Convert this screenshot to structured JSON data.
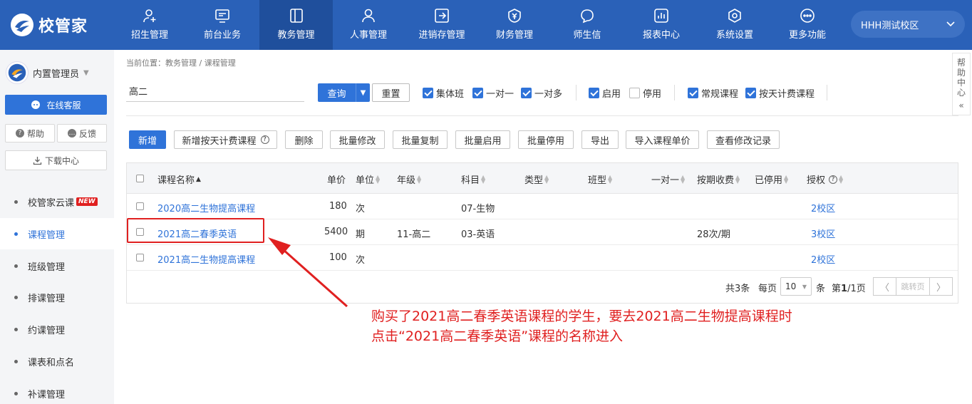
{
  "brand": {
    "name": "校管家"
  },
  "nav": [
    {
      "label": "招生管理",
      "icon": "user-plus-icon"
    },
    {
      "label": "前台业务",
      "icon": "monitor-icon"
    },
    {
      "label": "教务管理",
      "icon": "book-icon",
      "active": true
    },
    {
      "label": "人事管理",
      "icon": "person-icon"
    },
    {
      "label": "进销存管理",
      "icon": "inventory-icon"
    },
    {
      "label": "财务管理",
      "icon": "finance-icon"
    },
    {
      "label": "师生信",
      "icon": "chat-icon"
    },
    {
      "label": "报表中心",
      "icon": "report-icon"
    },
    {
      "label": "系统设置",
      "icon": "settings-icon"
    },
    {
      "label": "更多功能",
      "icon": "more-icon"
    }
  ],
  "campus": "HHH测试校区",
  "sidebar": {
    "user": "内置管理员",
    "kefu": "在线客服",
    "help": "帮助",
    "feedback": "反馈",
    "download": "下载中心",
    "new_tag": "NEW",
    "items": [
      {
        "label": "校管家云课",
        "new": true
      },
      {
        "label": "课程管理",
        "active": true
      },
      {
        "label": "班级管理"
      },
      {
        "label": "排课管理"
      },
      {
        "label": "约课管理"
      },
      {
        "label": "课表和点名"
      },
      {
        "label": "补课管理"
      }
    ]
  },
  "breadcrumb": "当前位置：教务管理 / 课程管理",
  "search": {
    "value": "高二",
    "query": "查询",
    "reset": "重置"
  },
  "filters": [
    {
      "label": "集体班",
      "checked": true
    },
    {
      "label": "一对一",
      "checked": true
    },
    {
      "label": "一对多",
      "checked": true
    },
    {
      "label": "启用",
      "checked": true
    },
    {
      "label": "停用",
      "checked": false
    },
    {
      "label": "常规课程",
      "checked": true
    },
    {
      "label": "按天计费课程",
      "checked": true
    }
  ],
  "actions": {
    "add": "新增",
    "add_daily": "新增按天计费课程",
    "delete": "删除",
    "batch_edit": "批量修改",
    "batch_copy": "批量复制",
    "batch_enable": "批量启用",
    "batch_disable": "批量停用",
    "export": "导出",
    "import_price": "导入课程单价",
    "view_log": "查看修改记录"
  },
  "table": {
    "headers": {
      "name": "课程名称",
      "price": "单价",
      "unit": "单位",
      "grade": "年级",
      "subject": "科目",
      "type": "类型",
      "class_type": "班型",
      "one_to_one": "一对一",
      "period_fee": "按期收费",
      "disabled": "已停用",
      "auth": "授权"
    },
    "rows": [
      {
        "name": "2020高二生物提高课程",
        "price": "180",
        "unit": "次",
        "grade": "",
        "subject": "07-生物",
        "period_fee": "",
        "auth": "2校区"
      },
      {
        "name": "2021高二春季英语",
        "price": "5400",
        "unit": "期",
        "grade": "11-高二",
        "subject": "03-英语",
        "period_fee": "28次/期",
        "auth": "3校区"
      },
      {
        "name": "2021高二生物提高课程",
        "price": "100",
        "unit": "次",
        "grade": "",
        "subject": "",
        "period_fee": "",
        "auth": "2校区"
      }
    ],
    "pagination": {
      "total": "共3条",
      "per_page_label": "每页",
      "per_page": "10",
      "unit": "条",
      "page_prefix": "第",
      "page_current": "1",
      "page_suffix": "/1页",
      "jump": "跳转页"
    }
  },
  "annotation": {
    "line1": "购买了2021高二春季英语课程的学生，要去2021高二生物提高课程时",
    "line2": "点击“2021高二春季英语”课程的名称进入",
    "color": "#e02020"
  },
  "helper": {
    "label": "帮助中心"
  }
}
